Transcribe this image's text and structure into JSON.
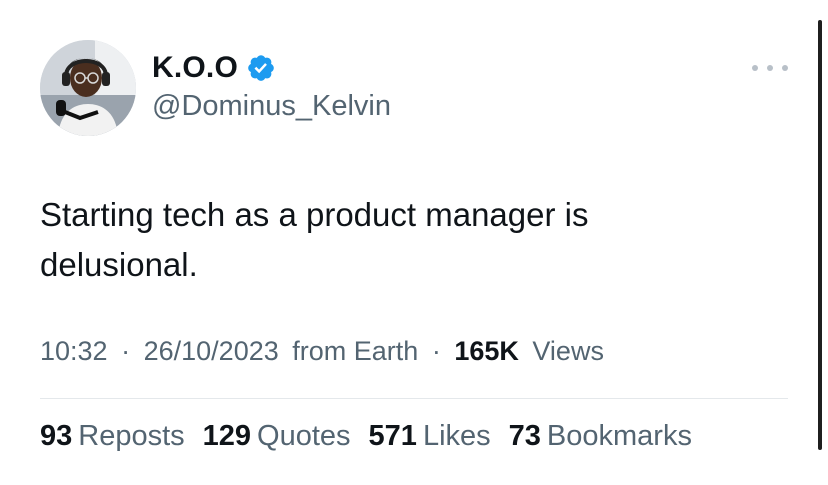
{
  "author": {
    "display_name": "K.O.O",
    "handle": "@Dominus_Kelvin",
    "verified": true,
    "badge_color": "#1d9bf0"
  },
  "menu": {
    "icon": "more-horizontal-icon"
  },
  "tweet": {
    "text_line1": "Starting tech as a product manager is",
    "text_line2": "delusional."
  },
  "meta": {
    "time": "10:32",
    "sep1": "·",
    "date": "26/10/2023",
    "source": "from Earth",
    "sep2": "·",
    "views_count": "165K",
    "views_label": "Views"
  },
  "stats": [
    {
      "count": "93",
      "label": "Reposts"
    },
    {
      "count": "129",
      "label": "Quotes"
    },
    {
      "count": "571",
      "label": "Likes"
    },
    {
      "count": "73",
      "label": "Bookmarks"
    }
  ],
  "colors": {
    "text_primary": "#0f1419",
    "text_secondary": "#536471",
    "divider": "#e4e8eb"
  }
}
